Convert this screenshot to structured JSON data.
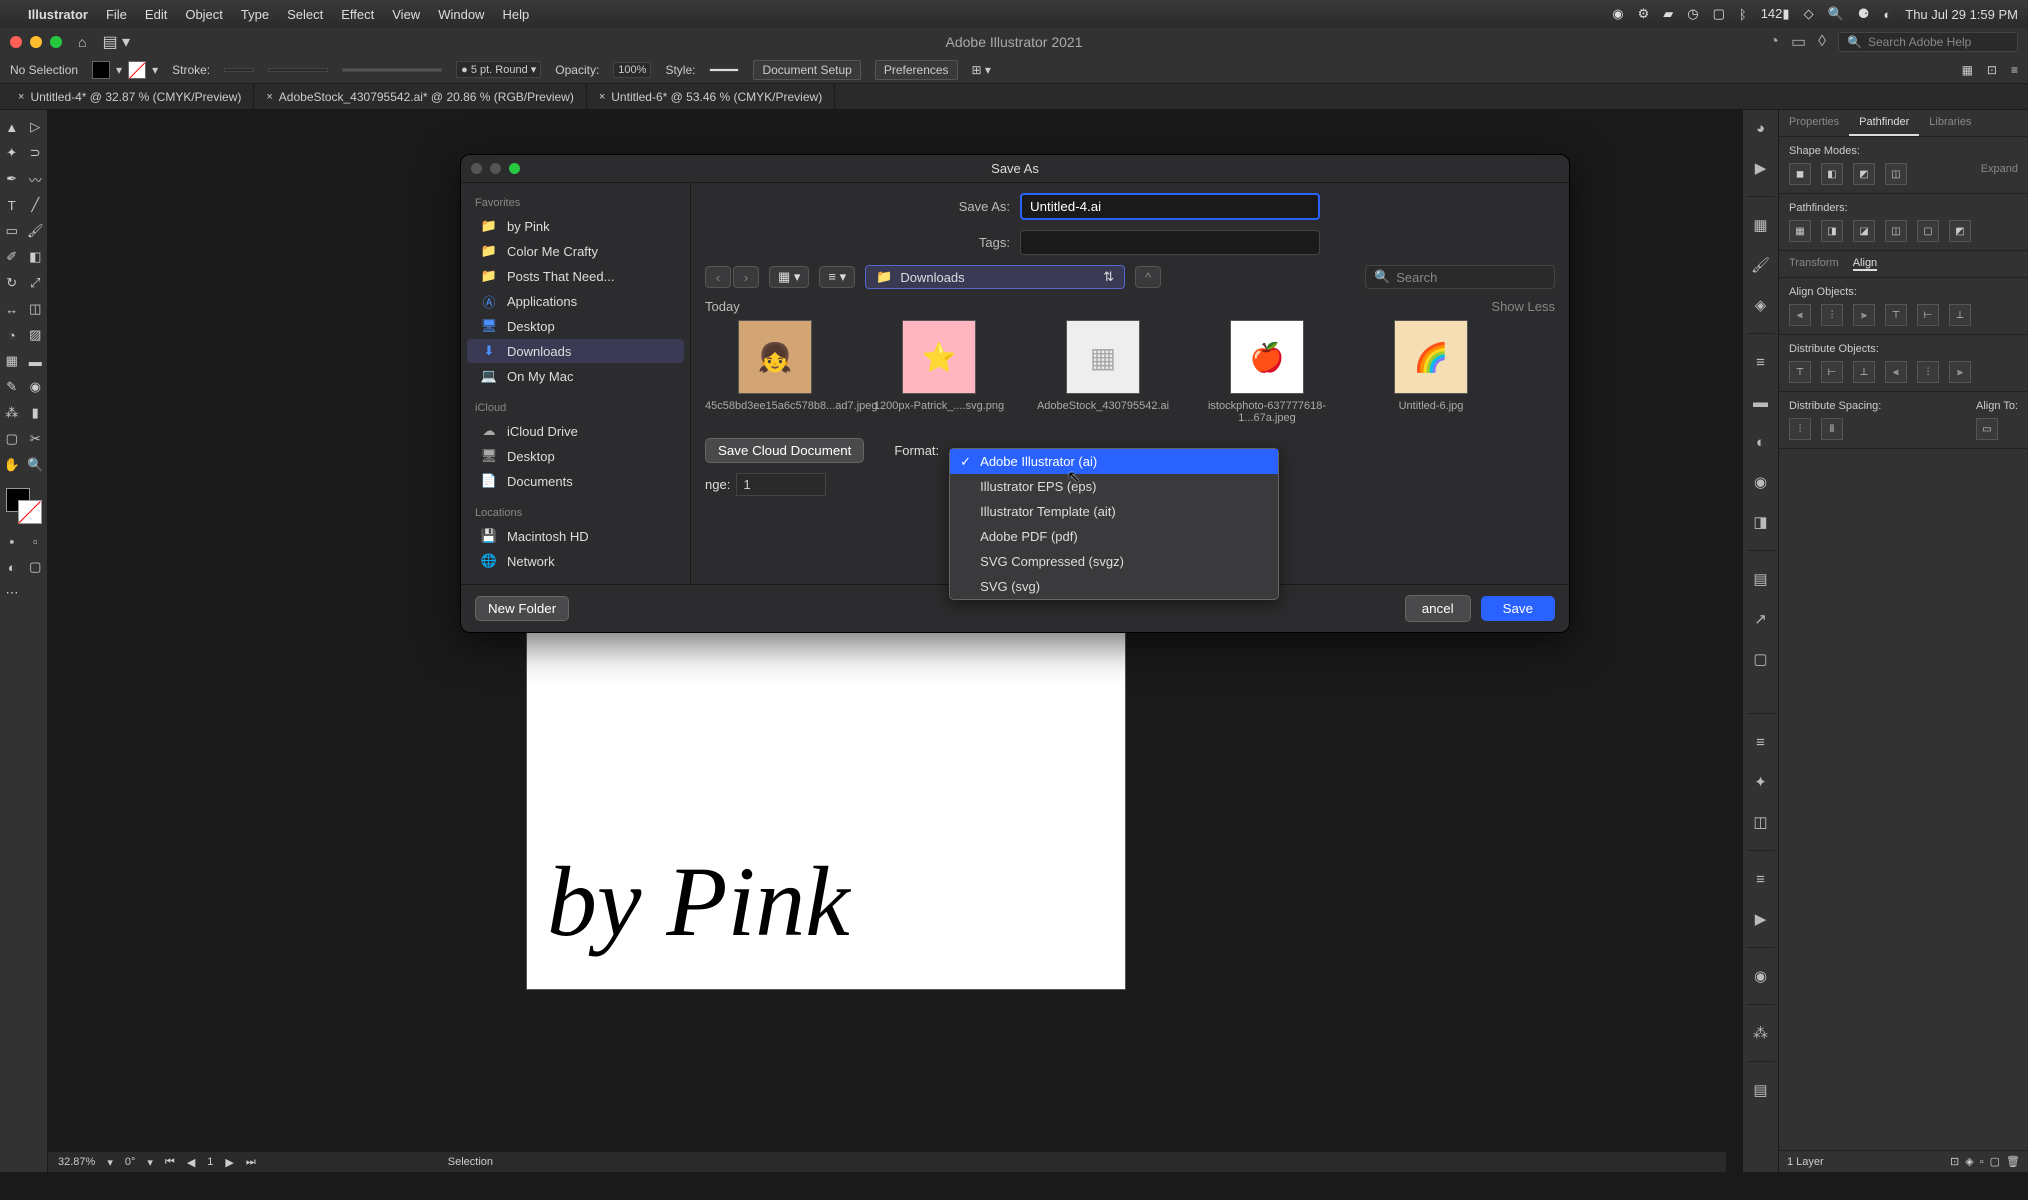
{
  "menubar": {
    "app_name": "Illustrator",
    "items": [
      "File",
      "Edit",
      "Object",
      "Type",
      "Select",
      "Effect",
      "View",
      "Window",
      "Help"
    ],
    "datetime": "Thu Jul 29  1:59 PM",
    "battery": "142"
  },
  "titlebar": {
    "title": "Adobe Illustrator 2021",
    "search_placeholder": "Search Adobe Help"
  },
  "controlbar": {
    "selection_label": "No Selection",
    "stroke_label": "Stroke:",
    "brush_label": "5 pt. Round",
    "opacity_label": "Opacity:",
    "opacity_value": "100%",
    "style_label": "Style:",
    "doc_setup": "Document Setup",
    "preferences": "Preferences"
  },
  "tabs": [
    "Untitled-4* @ 32.87 % (CMYK/Preview)",
    "AdobeStock_430795542.ai* @ 20.86 % (RGB/Preview)",
    "Untitled-6* @ 53.46 % (CMYK/Preview)"
  ],
  "dialog": {
    "title": "Save As",
    "saveas_label": "Save As:",
    "saveas_value": "Untitled-4.ai",
    "tags_label": "Tags:",
    "location": "Downloads",
    "search_placeholder": "Search",
    "today_label": "Today",
    "show_less": "Show Less",
    "favorites_header": "Favorites",
    "icloud_header": "iCloud",
    "locations_header": "Locations",
    "favorites": [
      "by Pink",
      "Color Me Crafty",
      "Posts That Need...",
      "Applications",
      "Desktop",
      "Downloads",
      "On My Mac"
    ],
    "icloud_items": [
      "iCloud Drive",
      "Desktop",
      "Documents"
    ],
    "locations": [
      "Macintosh HD",
      "Network"
    ],
    "files": [
      {
        "name": "45c58bd3ee15a6c578b8...ad7.jpeg"
      },
      {
        "name": "1200px-Patrick_....svg.png"
      },
      {
        "name": "AdobeStock_430795542.ai"
      },
      {
        "name": "istockphoto-637777618-1...67a.jpeg"
      },
      {
        "name": "Untitled-6.jpg"
      }
    ],
    "save_cloud": "Save Cloud Document",
    "format_label": "Format:",
    "formats": [
      "Adobe Illustrator (ai)",
      "Illustrator EPS (eps)",
      "Illustrator Template (ait)",
      "Adobe PDF (pdf)",
      "SVG Compressed (svgz)",
      "SVG (svg)"
    ],
    "range_label": "nge:",
    "range_value": "1",
    "new_folder": "New Folder",
    "cancel": "ancel",
    "save": "Save"
  },
  "right_panel": {
    "tabs": [
      "Properties",
      "Pathfinder",
      "Libraries"
    ],
    "shape_modes": "Shape Modes:",
    "expand": "Expand",
    "pathfinders": "Pathfinders:",
    "sub_tabs": [
      "Transform",
      "Align"
    ],
    "align_objects": "Align Objects:",
    "distribute_objects": "Distribute Objects:",
    "distribute_spacing": "Distribute Spacing:",
    "align_to": "Align To:",
    "layers_info": "1 Layer"
  },
  "footer": {
    "zoom": "32.87%",
    "rotation": "0°",
    "artboard": "1",
    "mode": "Selection"
  }
}
